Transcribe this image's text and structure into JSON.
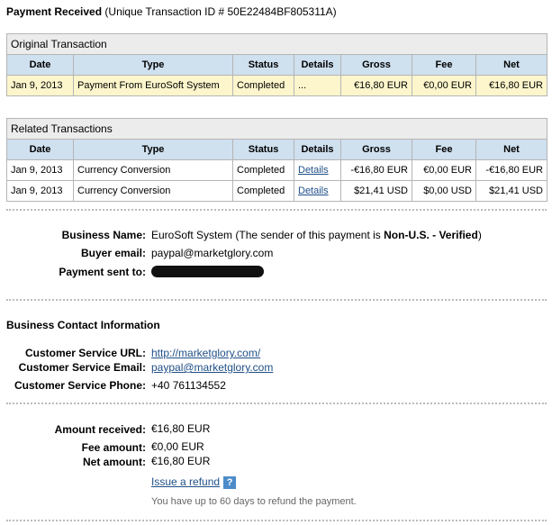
{
  "title": {
    "bold": "Payment Received",
    "rest": "(Unique Transaction ID # 50E22484BF805311A)"
  },
  "columns": [
    "Date",
    "Type",
    "Status",
    "Details",
    "Gross",
    "Fee",
    "Net"
  ],
  "original": {
    "caption": "Original Transaction",
    "row": [
      "Jan 9, 2013",
      "Payment From EuroSoft System",
      "Completed",
      "...",
      "€16,80 EUR",
      "€0,00 EUR",
      "€16,80 EUR"
    ]
  },
  "related": {
    "caption": "Related Transactions",
    "rows": [
      [
        "Jan 9, 2013",
        "Currency Conversion",
        "Completed",
        "Details",
        "-€16,80 EUR",
        "€0,00 EUR",
        "-€16,80 EUR"
      ],
      [
        "Jan 9, 2013",
        "Currency Conversion",
        "Completed",
        "Details",
        "$21,41 USD",
        "$0,00 USD",
        "$21,41 USD"
      ]
    ]
  },
  "business": {
    "name_label": "Business Name:",
    "name": "EuroSoft System (The sender of this payment is ",
    "status": "Non-U.S. - Verified",
    "close": ")",
    "email_label": "Buyer email:",
    "email": "paypal@marketglory.com",
    "sent_label": "Payment sent to:"
  },
  "contact": {
    "heading": "Business Contact Information",
    "url_label": "Customer Service URL:",
    "url": "http://marketglory.com/",
    "email_label": "Customer Service Email:",
    "email": "paypal@marketglory.com",
    "phone_label": "Customer Service Phone:",
    "phone": "+40 761134552"
  },
  "amounts": {
    "received_label": "Amount received:",
    "received": "€16,80 EUR",
    "fee_label": "Fee amount:",
    "fee": "€0,00 EUR",
    "net_label": "Net amount:",
    "net": "€16,80 EUR",
    "refund_link": "Issue a refund",
    "help": "?",
    "note": "You have up to 60 days to refund the payment."
  }
}
